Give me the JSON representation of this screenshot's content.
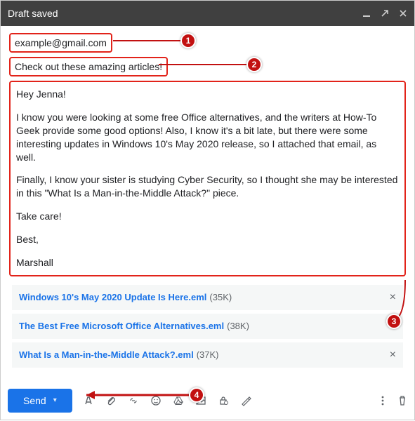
{
  "header": {
    "title": "Draft saved"
  },
  "to": {
    "value": "example@gmail.com"
  },
  "subject": {
    "value": "Check out these amazing articles!"
  },
  "body": {
    "p1": "Hey Jenna!",
    "p2": "I know you were looking at some free Office alternatives, and the writers at How-To Geek provide some good options! Also, I know it's a bit late, but there were some interesting updates in Windows 10's May 2020 release, so I attached that email, as well.",
    "p3": "Finally, I know your sister is studying Cyber Security, so I thought she may be interested in this \"What Is a Man-in-the-Middle Attack?\" piece.",
    "p4": "Take care!",
    "p5": "Best,",
    "p6": "Marshall"
  },
  "attachments": [
    {
      "name": "Windows 10's May 2020 Update Is Here.eml",
      "size": "(35K)"
    },
    {
      "name": "The Best Free Microsoft Office Alternatives.eml",
      "size": "(38K)"
    },
    {
      "name": "What Is a Man-in-the-Middle Attack?.eml",
      "size": "(37K)"
    }
  ],
  "footer": {
    "send": "Send"
  },
  "callouts": {
    "c1": "1",
    "c2": "2",
    "c3": "3",
    "c4": "4"
  }
}
